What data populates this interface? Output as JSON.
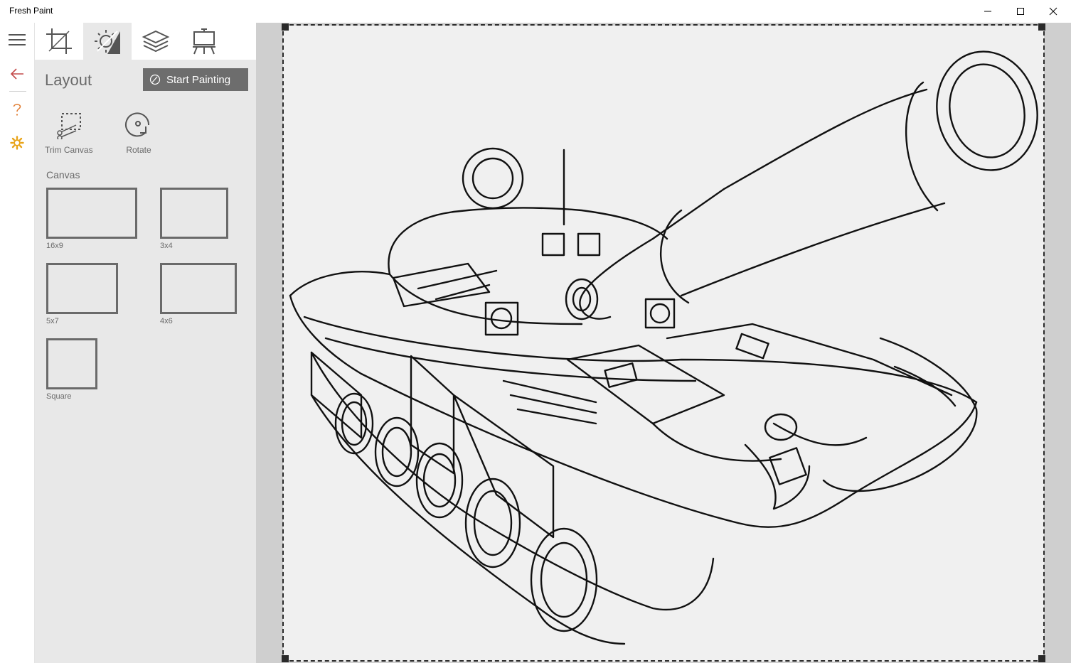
{
  "window": {
    "title": "Fresh Paint",
    "controls": [
      "minimize-icon",
      "maximize-icon",
      "close-icon"
    ]
  },
  "rail": {
    "items": [
      "menu-icon",
      "back-arrow-icon",
      "help-icon",
      "settings-icon"
    ]
  },
  "tabs": [
    {
      "icon": "crop-icon",
      "active": false
    },
    {
      "icon": "photo-adjust-icon",
      "active": true
    },
    {
      "icon": "layers-icon",
      "active": false
    },
    {
      "icon": "easel-icon",
      "active": false
    }
  ],
  "layout": {
    "title": "Layout",
    "start_painting": "Start Painting",
    "tools": [
      {
        "label": "Trim Canvas",
        "icon": "trim-canvas-icon"
      },
      {
        "label": "Rotate",
        "icon": "rotate-icon"
      }
    ],
    "canvas_heading": "Canvas",
    "presets": [
      {
        "label": "16x9"
      },
      {
        "label": "3x4"
      },
      {
        "label": "5x7"
      },
      {
        "label": "4x6"
      },
      {
        "label": "Square"
      }
    ]
  },
  "colors": {
    "accent_back": "#c44b4b",
    "accent_help": "#e07a2e",
    "accent_settings": "#e8a317",
    "panel": "#e8e8e8",
    "button": "#6d6d6d"
  }
}
